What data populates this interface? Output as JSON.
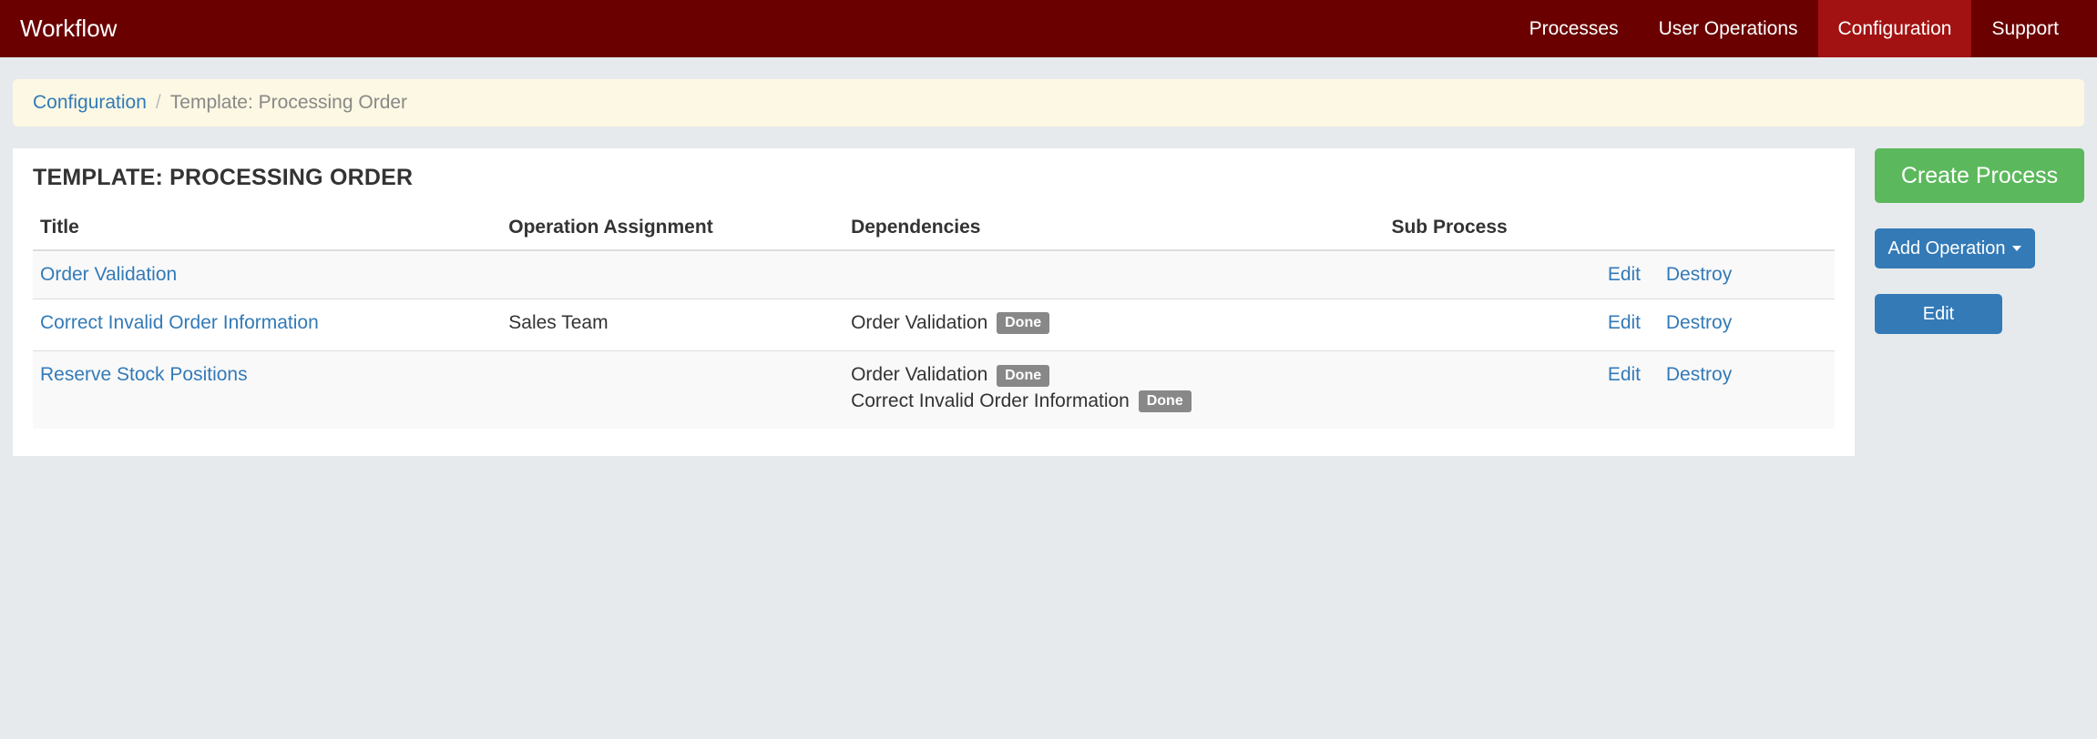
{
  "navbar": {
    "brand": "Workflow",
    "items": [
      {
        "label": "Processes",
        "active": false
      },
      {
        "label": "User Operations",
        "active": false
      },
      {
        "label": "Configuration",
        "active": true
      },
      {
        "label": "Support",
        "active": false
      }
    ]
  },
  "breadcrumb": {
    "link": "Configuration",
    "sep": "/",
    "current": "Template: Processing Order"
  },
  "panel": {
    "title": "Template: Processing Order",
    "columns": [
      "Title",
      "Operation Assignment",
      "Dependencies",
      "Sub Process",
      ""
    ],
    "rows": [
      {
        "title": "Order Validation",
        "assignment": "",
        "dependencies": [],
        "subprocess": "",
        "edit": "Edit",
        "destroy": "Destroy"
      },
      {
        "title": "Correct Invalid Order Information",
        "assignment": "Sales Team",
        "dependencies": [
          {
            "name": "Order Validation",
            "status": "Done"
          }
        ],
        "subprocess": "",
        "edit": "Edit",
        "destroy": "Destroy"
      },
      {
        "title": "Reserve Stock Positions",
        "assignment": "",
        "dependencies": [
          {
            "name": "Order Validation",
            "status": "Done"
          },
          {
            "name": "Correct Invalid Order Information",
            "status": "Done"
          }
        ],
        "subprocess": "",
        "edit": "Edit",
        "destroy": "Destroy"
      }
    ]
  },
  "sidebar": {
    "create_process": "Create Process",
    "add_operation": "Add Operation",
    "edit": "Edit"
  }
}
